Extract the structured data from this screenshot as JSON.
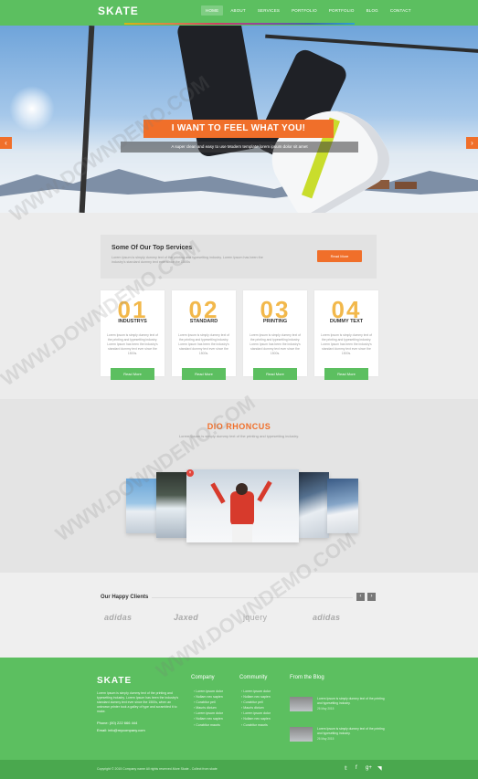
{
  "header": {
    "logo": "SKATE",
    "nav": [
      "HOME",
      "ABOUT",
      "SERVICES",
      "PORTFOLIO",
      "PORTFOLIO",
      "BLOG",
      "CONTACT"
    ]
  },
  "hero": {
    "title": "I WANT TO FEEL WHAT YOU!",
    "subtitle": "A super clean and easy to use Modern template lorem ipsum dolor sit amet"
  },
  "services": {
    "title": "Some Of Our Top Services",
    "text": "Lorem Ipsum is simply dummy text of the printing and typesetting industry. Lorem Ipsum has been the industry's standard dummy text ever since the 1500s",
    "button": "Read More",
    "cards": [
      {
        "num": "01",
        "title": "INDUSTRYS",
        "text": "Lorem Ipsum is simply dummy text of the printing and typesetting industry. Lorem Ipsum has been the industry's standard dummy text ever since the 1500s.",
        "button": "Read More"
      },
      {
        "num": "02",
        "title": "STANDARD",
        "text": "Lorem Ipsum is simply dummy text of the printing and typesetting industry. Lorem Ipsum has been the industry's standard dummy text ever since the 1500s.",
        "button": "Read More"
      },
      {
        "num": "03",
        "title": "PRINTING",
        "text": "Lorem Ipsum is simply dummy text of the printing and typesetting industry. Lorem Ipsum has been the industry's standard dummy text ever since the 1500s.",
        "button": "Read More"
      },
      {
        "num": "04",
        "title": "DUMMY TEXT",
        "text": "Lorem Ipsum is simply dummy text of the printing and typesetting industry. Lorem Ipsum has been the industry's standard dummy text ever since the 1500s.",
        "button": "Read More"
      }
    ]
  },
  "gallery": {
    "title": "DIO RHONCUS",
    "subtitle": "Lorem Ipsum is simply dummy text of the printing and typesetting industry."
  },
  "clients": {
    "title": "Our Happy Clients",
    "logos": [
      "adidas",
      "Jaxed",
      "jquery",
      "adidas"
    ]
  },
  "footer": {
    "logo": "SKATE",
    "about": "Lorem Ipsum is simply dummy text of the printing and typesetting industry. Lorem Ipsum has been the industry's standard dummy text ever since the 1500s, when an unknown printer took a galley of type and scrambled it to make.",
    "phone": "Phone: (00) 222 666 444",
    "email": "Email: info@mycompany.com",
    "company_title": "Company",
    "company_links": [
      "Lorem ipsum dolor",
      "Nullam nec sapien",
      "Curabitur pell",
      "Mauris dictum",
      "Lorem ipsum dolor",
      "Nullam nec sapien",
      "Curabitur mauris"
    ],
    "community_title": "Community",
    "community_links": [
      "Lorem ipsum dolor",
      "Nullam nec sapien",
      "Curabitur pell",
      "Mauris dictum",
      "Lorem ipsum dolor",
      "Nullam nec sapien",
      "Curabitur mauris"
    ],
    "blog_title": "From the  Blog",
    "blog_items": [
      {
        "text": "Lorem Ipsum is simply dummy text of the printing and typesetting industry.",
        "date": "26 May 2015"
      },
      {
        "text": "Lorem Ipsum is simply dummy text of the printing and typesetting industry.",
        "date": "26 May 2015"
      }
    ],
    "copyright": "Copyright © 2015 Company name All rights reserved.More Skate - Collect from skate"
  },
  "watermark": "WWW.DOWNDEMO.COM",
  "colors": {
    "accent": "#f06f2a",
    "brand": "#5cbf60"
  }
}
